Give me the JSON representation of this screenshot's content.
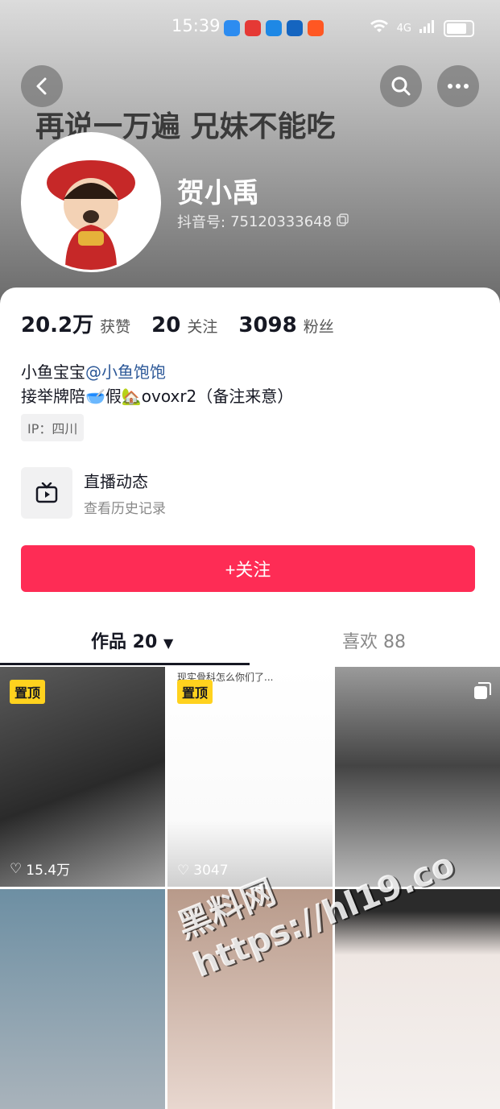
{
  "status": {
    "time": "15:39",
    "network": "4G"
  },
  "banner": {
    "text": "再说一万遍 兄妹不能吃"
  },
  "profile": {
    "name": "贺小禹",
    "id_label": "抖音号:",
    "id_value": "75120333648"
  },
  "stats": [
    {
      "num": "20.2万",
      "label": "获赞"
    },
    {
      "num": "20",
      "label": "关注"
    },
    {
      "num": "3098",
      "label": "粉丝"
    }
  ],
  "bio": {
    "line1_prefix": "小鱼宝宝",
    "line1_mention": "@小鱼饱饱",
    "line2": "接举牌陪🥣假🏡ovoxr2（备注来意）"
  },
  "ip": "IP：四川",
  "live": {
    "title": "直播动态",
    "subtitle": "查看历史记录"
  },
  "follow_button": "+关注",
  "tabs": {
    "works": "作品 20",
    "likes": "喜欢 88"
  },
  "videos": [
    {
      "pinned": "置顶",
      "likes": "15.4万",
      "caption": ""
    },
    {
      "pinned": "置顶",
      "likes": "3047",
      "caption": "现实骨科怎么你们了..."
    },
    {
      "pinned": "",
      "likes": "",
      "caption": ""
    },
    {
      "pinned": "",
      "likes": "",
      "caption": ""
    },
    {
      "pinned": "",
      "likes": "",
      "caption": ""
    },
    {
      "pinned": "",
      "likes": "",
      "caption": ""
    }
  ],
  "watermark": {
    "line1": "黑料网",
    "line2": "https://hl19.co"
  },
  "colors": {
    "accent": "#fe2c55",
    "pin": "#ffd21e",
    "mention": "#2b5797"
  }
}
